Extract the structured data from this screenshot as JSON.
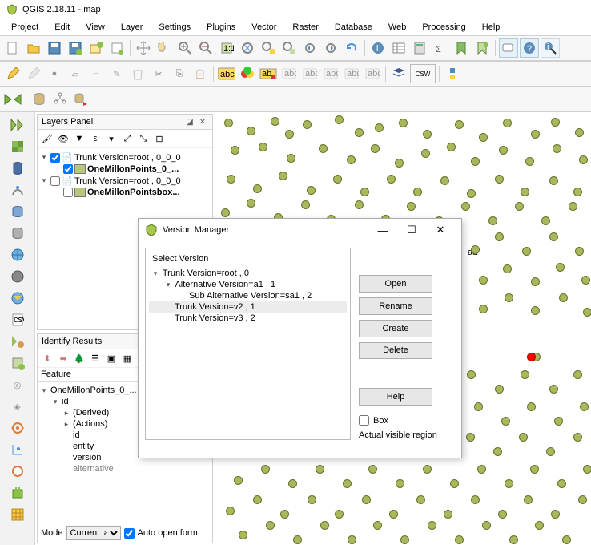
{
  "window": {
    "title": "QGIS 2.18.11 - map"
  },
  "menu": [
    "Project",
    "Edit",
    "View",
    "Layer",
    "Settings",
    "Plugins",
    "Vector",
    "Raster",
    "Database",
    "Web",
    "Processing",
    "Help"
  ],
  "layers_panel": {
    "title": "Layers Panel",
    "tree": {
      "root1": "Trunk Version=root , 0_0_0",
      "child1": "OneMillonPoints_0_...",
      "root2": "Trunk Version=root , 0_0_0",
      "child2": "OneMillonPointsbox..."
    }
  },
  "identify": {
    "title": "Identify Results",
    "feature": "Feature",
    "root": "OneMillonPoints_0_...",
    "id": "id",
    "derived": "(Derived)",
    "actions": "(Actions)",
    "id2": "id",
    "entity": "entity",
    "version": "version",
    "alt": "alternative",
    "mode": "Mode",
    "modeval": "Current la",
    "autoform": "Auto open form"
  },
  "dialog": {
    "title": "Version Manager",
    "select": "Select Version",
    "items": {
      "trunk_root": "Trunk Version=root , 0",
      "alt1": "Alternative Version=a1 , 1",
      "subalt": "Sub Alternative Version=sa1 , 2",
      "v2": "Trunk Version=v2 , 1",
      "v3": "Trunk Version=v3 , 2"
    },
    "buttons": {
      "open": "Open",
      "rename": "Rename",
      "create": "Create",
      "delete": "Delete",
      "help": "Help"
    },
    "box": "Box",
    "region": "Actual visible region"
  },
  "canvas": {
    "label_aa": "aa"
  },
  "chart_data": {
    "type": "scatter",
    "title": "",
    "xlabel": "",
    "ylabel": "",
    "series": [
      {
        "name": "OneMillonPoints",
        "color": "#a9b85a",
        "points": 160
      },
      {
        "name": "highlight",
        "color": "#ff0000",
        "points": 1
      }
    ],
    "annotations": [
      "aa"
    ]
  }
}
